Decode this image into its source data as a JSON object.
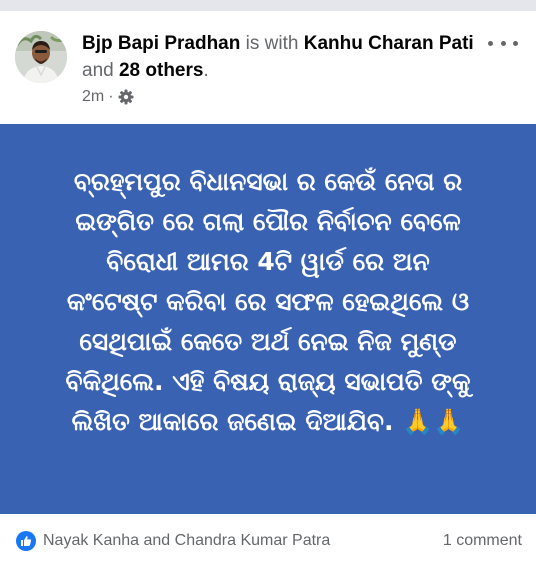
{
  "post": {
    "author": "Bjp Bapi Pradhan",
    "with_text": " is with ",
    "tagged_person": "Kanhu Charan Pati",
    "and_text": " and ",
    "others": "28 others",
    "period": ".",
    "time": "2m",
    "separator": "·",
    "privacy_icon": "gear-icon",
    "more_icon": "more-options-icon"
  },
  "banner": {
    "background_color": "#3a62b3",
    "text": "ବ୍ରହ୍ମପୁର ବିଧାନସଭା ର କେଉଁ ନେତା ର\nଇଙ୍ଗିତ ରେ ଗଲା ପୌର ନିର୍ବାଚନ ବେଳେ\nବିରୋଧୀ ଆମର 4ଟି ୱାର୍ଡ ରେ ଅନ\nକଂଟେଷ୍ଟ କରିବା ରେ ସଫଳ ହେଇଥିଲେ ଓ\nସେଥିପାଇଁ କେତେ ଅର୍ଥ ନେଇ ନିଜ ମୁଣ୍ଡ\nବିକିଥିଲେ. ଏହି ବିଷୟ ରାଜ୍ୟ ସଭାପତି ଙ୍କୁ\nଲିଖିତ ଆକାରେ ଜଣେଇ ଦିଆଯିବ. 🙏🙏"
  },
  "footer": {
    "reaction_icon": "like-icon",
    "reactions": "Nayak Kanha and Chandra Kumar Patra",
    "comments": "1 comment"
  },
  "colors": {
    "page_background": "#e4e6eb",
    "secondary_text": "#65676b",
    "like_blue": "#1877f2"
  }
}
